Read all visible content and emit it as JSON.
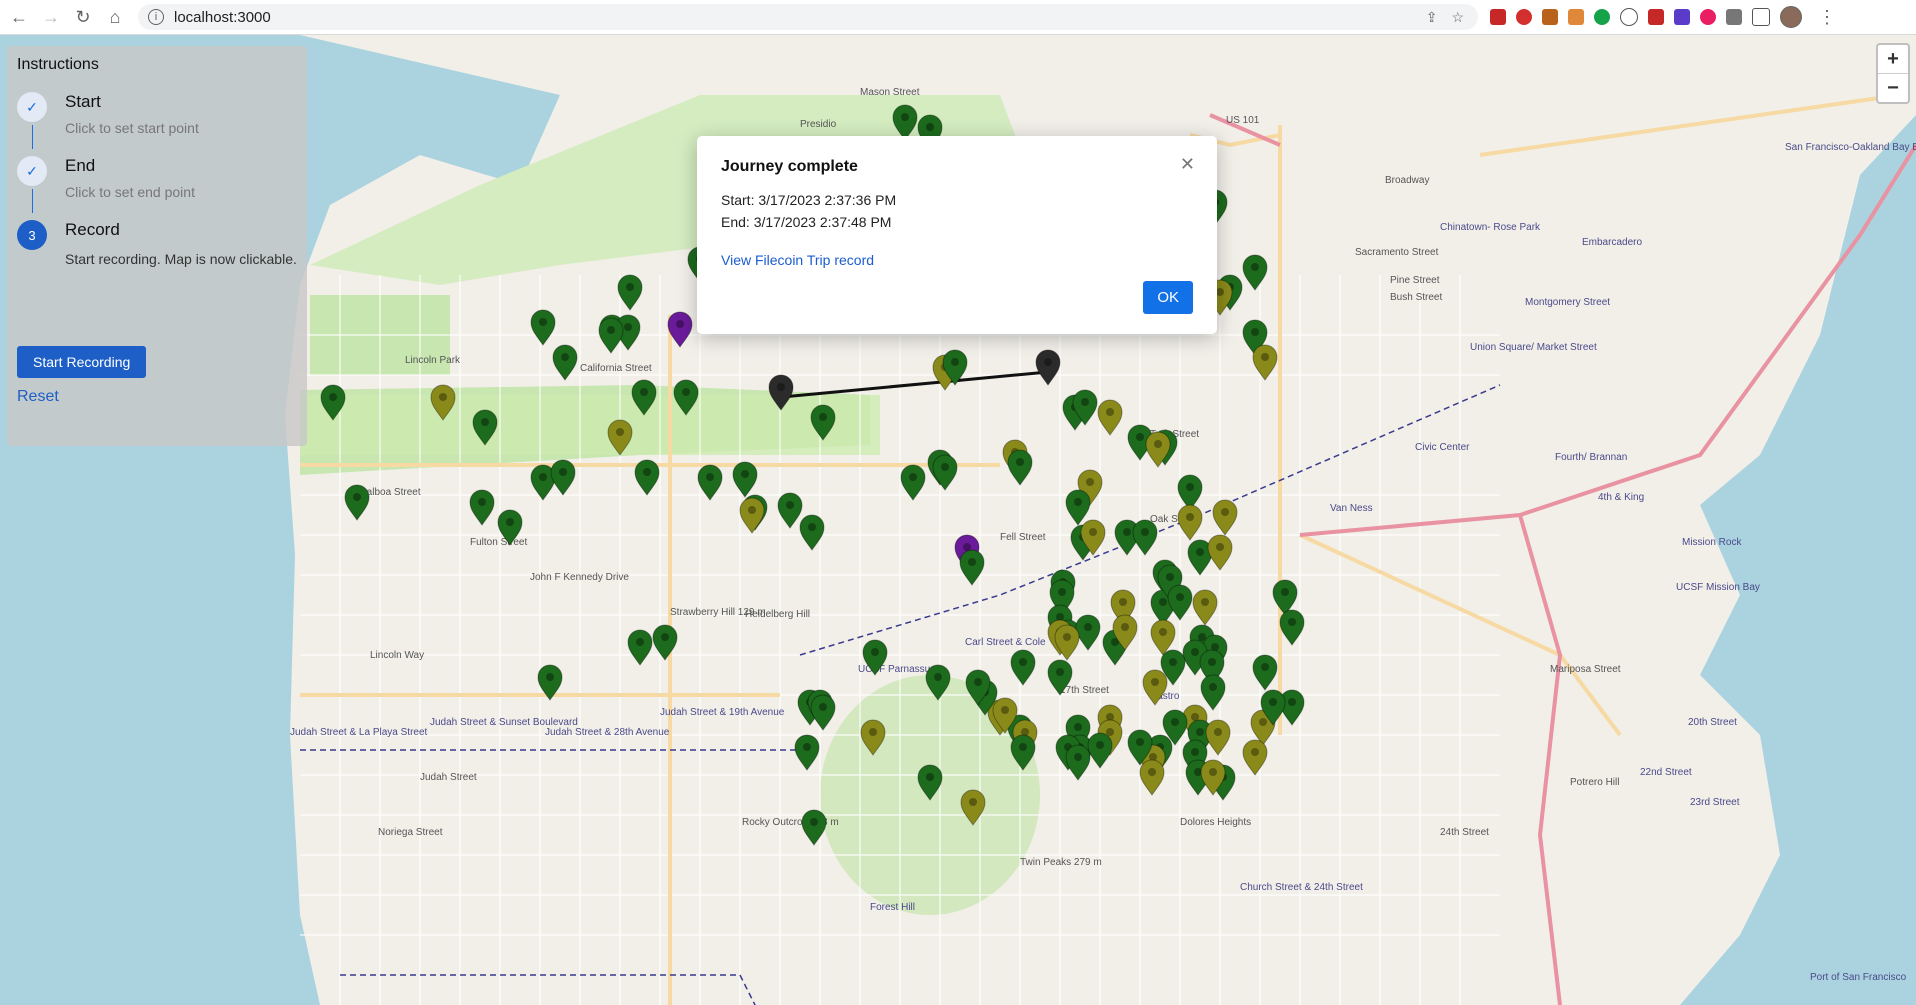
{
  "browser": {
    "url": "localhost:3000"
  },
  "panel": {
    "title": "Instructions",
    "steps": [
      {
        "marker": "✓",
        "title": "Start",
        "desc": "Click to set start point"
      },
      {
        "marker": "✓",
        "title": "End",
        "desc": "Click to set end point"
      },
      {
        "marker": "3",
        "title": "Record",
        "desc": "Start recording. Map is now clickable."
      }
    ],
    "start_button": "Start Recording",
    "reset_link": "Reset"
  },
  "map": {
    "zoom_in": "+",
    "zoom_out": "−",
    "labels": [
      "Presidio",
      "Mason Street",
      "Lincoln Park",
      "California Street",
      "Balboa Street",
      "Fulton Street",
      "John F Kennedy Drive",
      "Lincoln Way",
      "Judah Street",
      "Noriega Street",
      "Strawberry Hill 129 m",
      "Heidelberg Hill",
      "Carl Street & Cole",
      "UCSF Parnassus",
      "Twin Peaks 279 m",
      "Castro",
      "Dolores Heights",
      "Civic Center",
      "Van Ness",
      "Union Square/ Market Street",
      "Montgomery Street",
      "Embarcadero",
      "Chinatown- Rose Park",
      "Fourth/ Brannan",
      "4th & King",
      "Mission Rock",
      "UCSF Mission Bay",
      "20th Street",
      "22nd Street",
      "23rd Street",
      "Potrero Hill",
      "San Francisco-Oakland Bay Bridge West Span",
      "Judah Street & La Playa Street",
      "Judah Street & Sunset Boulevard",
      "Judah Street & 28th Avenue",
      "Judah Street & 19th Avenue",
      "Forest Hill",
      "Rocky Outcrop 228 m",
      "Port of San Francisco",
      "US 101",
      "Pine Street",
      "Bush Street",
      "Sacramento Street",
      "Broadway",
      "Turk Street",
      "Oak Street",
      "Fell Street",
      "17th Street",
      "24th Street",
      "Mariposa Street",
      "Church Street & 24th Street"
    ]
  },
  "modal": {
    "title": "Journey complete",
    "start": "Start: 3/17/2023 2:37:36 PM",
    "end": "End: 3/17/2023 2:37:48 PM",
    "link": "View Filecoin Trip record",
    "ok": "OK",
    "close": "✕"
  },
  "colors": {
    "pin_green": "#1d6b1d",
    "pin_olive": "#8a8a1a",
    "pin_purple": "#6a1b9a",
    "pin_dark": "#2b2b2b",
    "accent": "#1d5fc6"
  }
}
